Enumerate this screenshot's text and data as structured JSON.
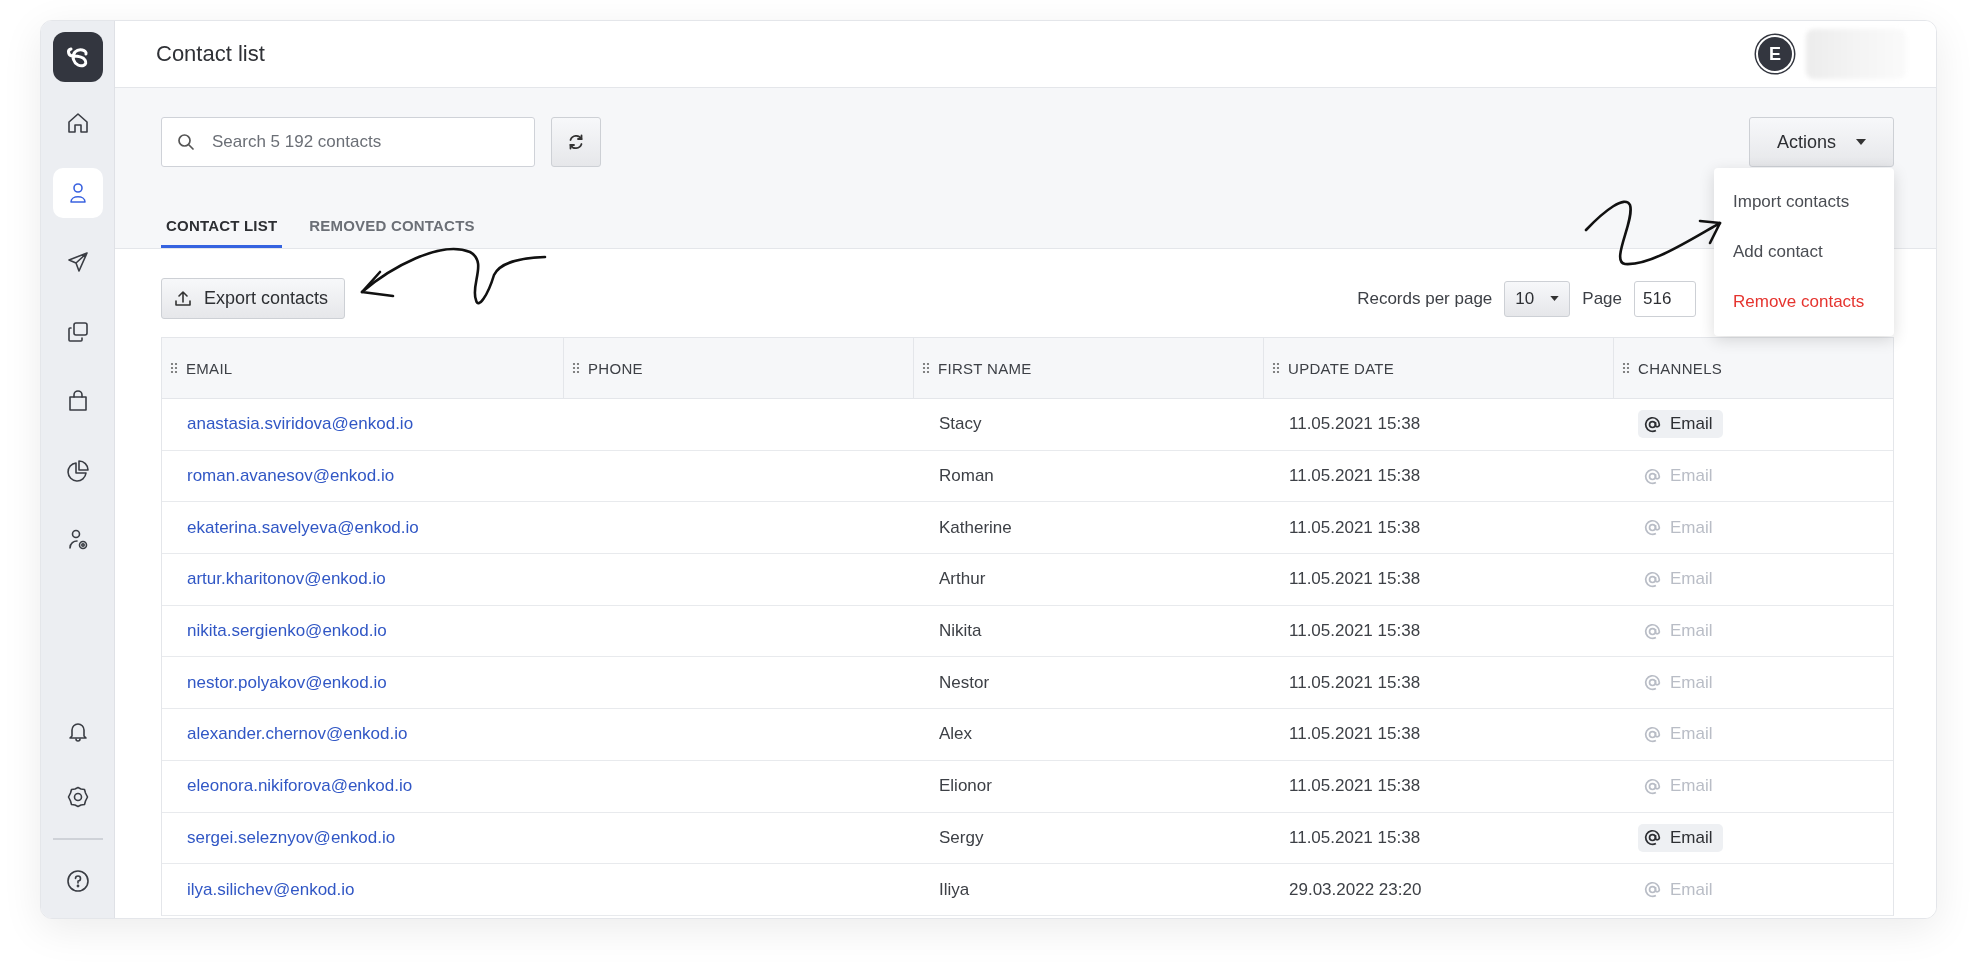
{
  "sidebar": {
    "items": [
      {
        "kind": "home",
        "selected": false
      },
      {
        "kind": "contacts",
        "selected": true
      },
      {
        "kind": "send",
        "selected": false
      },
      {
        "kind": "copies",
        "selected": false
      },
      {
        "kind": "bag",
        "selected": false
      },
      {
        "kind": "chart",
        "selected": false
      },
      {
        "kind": "user-settings",
        "selected": false
      }
    ],
    "bottom_items": [
      {
        "kind": "bell",
        "selected": false
      },
      {
        "kind": "settings",
        "selected": false
      },
      {
        "kind": "help",
        "selected": false
      }
    ]
  },
  "header": {
    "title": "Contact list",
    "avatar": "E"
  },
  "search": {
    "placeholder": "Search 5 192 contacts"
  },
  "actions": {
    "label": "Actions",
    "menu": [
      {
        "label": "Import contacts",
        "kind": "normal"
      },
      {
        "label": "Add contact",
        "kind": "normal"
      },
      {
        "label": "Remove contacts",
        "kind": "danger"
      }
    ]
  },
  "tabs": [
    {
      "label": "CONTACT LIST",
      "selected": true
    },
    {
      "label": "REMOVED CONTACTS",
      "selected": false
    }
  ],
  "export_button": "Export contacts",
  "pagination": {
    "records_label": "Records per page",
    "per_page": "10",
    "page_label": "Page",
    "page": "516"
  },
  "table": {
    "columns": [
      "EMAIL",
      "PHONE",
      "FIRST NAME",
      "UPDATE DATE",
      "CHANNELS"
    ],
    "rows": [
      {
        "email": "anastasia.sviridova@enkod.io",
        "phone": "",
        "first_name": "Stacy",
        "update_date": "11.05.2021 15:38",
        "channel": {
          "label": "Email",
          "active": true
        }
      },
      {
        "email": "roman.avanesov@enkod.io",
        "phone": "",
        "first_name": "Roman",
        "update_date": "11.05.2021 15:38",
        "channel": {
          "label": "Email",
          "active": false
        }
      },
      {
        "email": "ekaterina.savelyeva@enkod.io",
        "phone": "",
        "first_name": "Katherine",
        "update_date": "11.05.2021 15:38",
        "channel": {
          "label": "Email",
          "active": false
        }
      },
      {
        "email": "artur.kharitonov@enkod.io",
        "phone": "",
        "first_name": "Arthur",
        "update_date": "11.05.2021 15:38",
        "channel": {
          "label": "Email",
          "active": false
        }
      },
      {
        "email": "nikita.sergienko@enkod.io",
        "phone": "",
        "first_name": "Nikita",
        "update_date": "11.05.2021 15:38",
        "channel": {
          "label": "Email",
          "active": false
        }
      },
      {
        "email": "nestor.polyakov@enkod.io",
        "phone": "",
        "first_name": "Nestor",
        "update_date": "11.05.2021 15:38",
        "channel": {
          "label": "Email",
          "active": false
        }
      },
      {
        "email": "alexander.chernov@enkod.io",
        "phone": "",
        "first_name": "Alex",
        "update_date": "11.05.2021 15:38",
        "channel": {
          "label": "Email",
          "active": false
        }
      },
      {
        "email": "eleonora.nikiforova@enkod.io",
        "phone": "",
        "first_name": "Elionor",
        "update_date": "11.05.2021 15:38",
        "channel": {
          "label": "Email",
          "active": false
        }
      },
      {
        "email": "sergei.seleznyov@enkod.io",
        "phone": "",
        "first_name": "Sergy",
        "update_date": "11.05.2021 15:38",
        "channel": {
          "label": "Email",
          "active": true
        }
      },
      {
        "email": "ilya.silichev@enkod.io",
        "phone": "",
        "first_name": "Iliya",
        "update_date": "29.03.2022 23:20",
        "channel": {
          "label": "Email",
          "active": false
        }
      }
    ]
  }
}
